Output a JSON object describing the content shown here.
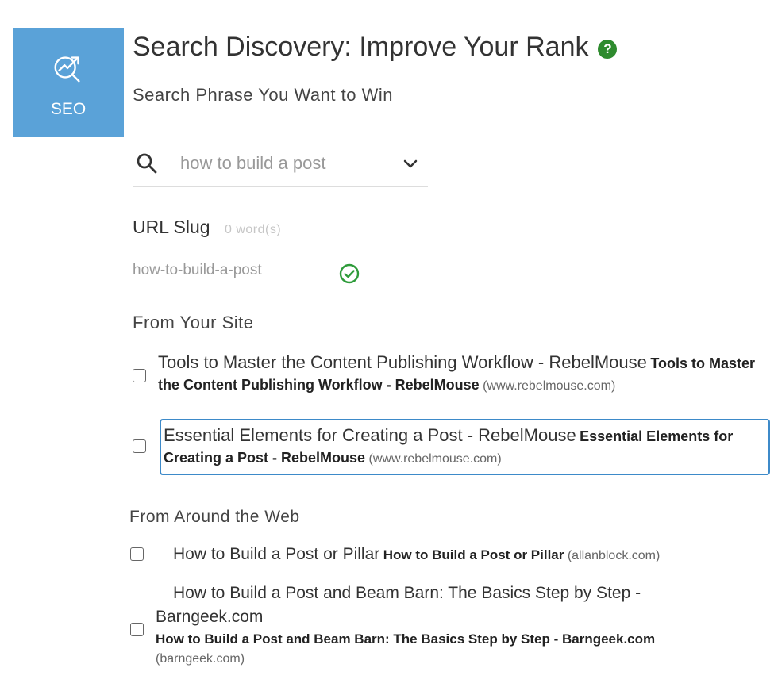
{
  "tile": {
    "label": "SEO",
    "color": "#5aa2d8"
  },
  "header": {
    "title": "Search Discovery: Improve Your Rank",
    "help_glyph": "?"
  },
  "search": {
    "subtitle": "Search Phrase You Want to Win",
    "value": "how to build a post"
  },
  "slug": {
    "label": "URL Slug",
    "count": "0 word(s)",
    "value": "how-to-build-a-post"
  },
  "from_site": {
    "heading": "From Your Site",
    "items": [
      {
        "title": "Tools to Master the Content Publishing Workflow - RebelMouse",
        "bold": "Tools to Master the Content Publishing Workflow - RebelMouse",
        "host": "(www.rebelmouse.com)"
      },
      {
        "title": "Essential Elements for Creating a Post - RebelMouse",
        "bold": "Essential Elements for Creating a Post - RebelMouse",
        "host": "(www.rebelmouse.com)"
      }
    ]
  },
  "from_web": {
    "heading": "From Around the Web",
    "items": [
      {
        "title": "How to Build a Post or Pillar",
        "bold": "How to Build a Post or Pillar",
        "host": "(allanblock.com)"
      },
      {
        "title": "How to Build a Post and Beam Barn: The Basics Step by Step - Barngeek.com",
        "bold": "How to Build a Post and Beam Barn: The Basics Step by Step - Barngeek.com",
        "host": "(barngeek.com)"
      }
    ]
  },
  "colors": {
    "accent_green": "#2e8b2e",
    "focus_blue": "#3d8ac9"
  }
}
